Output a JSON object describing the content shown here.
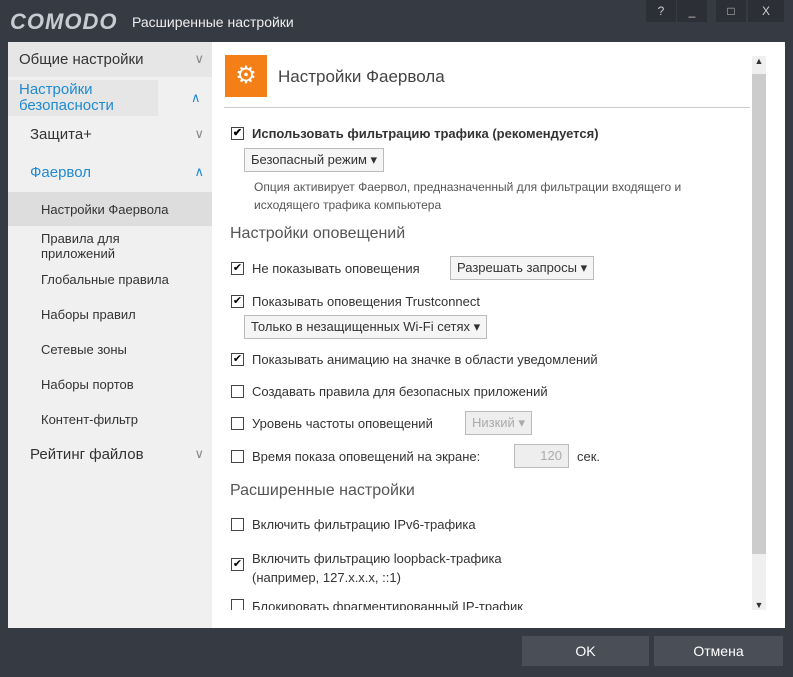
{
  "title": {
    "logo": "COMODO",
    "text": "Расширенные настройки",
    "help": "?",
    "minimize": "_",
    "maximize": "□",
    "close": "X"
  },
  "sidebar": {
    "items": [
      {
        "label": "Общие настройки",
        "chev": "∨"
      },
      {
        "label": "Настройки безопасности",
        "chev": "∧"
      },
      {
        "label": "Защита+",
        "chev": "∨"
      },
      {
        "label": "Фаервол",
        "chev": "∧"
      },
      {
        "label": "Настройки Фаервола"
      },
      {
        "label": "Правила для приложений"
      },
      {
        "label": "Глобальные правила"
      },
      {
        "label": "Наборы правил"
      },
      {
        "label": "Сетевые зоны"
      },
      {
        "label": "Наборы портов"
      },
      {
        "label": "Контент-фильтр"
      },
      {
        "label": "Рейтинг файлов",
        "chev": "∨"
      }
    ]
  },
  "main": {
    "title": "Настройки Фаервола",
    "filter": {
      "label": "Использовать фильтрацию трафика (рекомендуется)",
      "checked": true,
      "mode": "Безопасный режим",
      "desc": "Опция активирует Фаервол, предназначенный для фильтрации входящего и исходящего трафика компьютера"
    },
    "alerts_title": "Настройки оповещений",
    "alerts": [
      {
        "label": "Не показывать оповещения",
        "checked": true,
        "select": "Разрешать запросы"
      },
      {
        "label": "Показывать оповещения Trustconnect",
        "checked": true,
        "select": "Только в незащищенных Wi-Fi сетях"
      },
      {
        "label": "Показывать анимацию на значке в области уведомлений",
        "checked": true
      },
      {
        "label": "Создавать правила для безопасных приложений",
        "checked": false
      },
      {
        "label": "Уровень частоты оповещений",
        "checked": false,
        "select": "Низкий"
      },
      {
        "label": "Время показа оповещений на экране:",
        "checked": false,
        "value": "120",
        "unit": "сек."
      }
    ],
    "advanced_title": "Расширенные настройки",
    "advanced": [
      {
        "label": "Включить фильтрацию IPv6-трафика",
        "checked": false
      },
      {
        "label": "Включить фильтрацию loopback-трафика",
        "label2": "(например, 127.x.x.x, ::1)",
        "checked": true
      },
      {
        "label": "Блокировать фрагментированный IP-трафик",
        "checked": false
      }
    ]
  },
  "footer": {
    "ok": "OK",
    "cancel": "Отмена"
  }
}
